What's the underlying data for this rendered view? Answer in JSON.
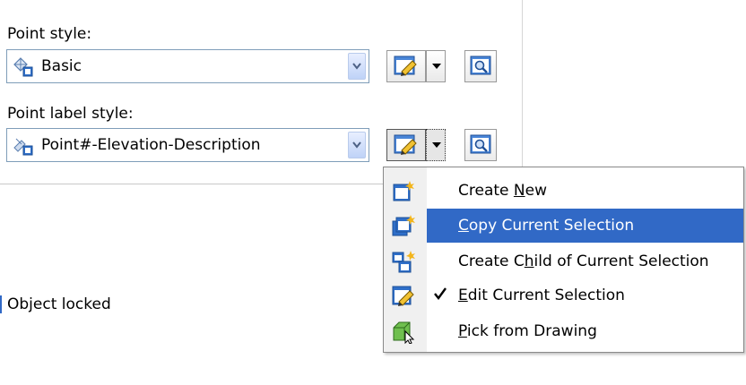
{
  "point_style": {
    "label": "Point style:",
    "selected": "Basic",
    "icon": "point-style-icon"
  },
  "point_label_style": {
    "label": "Point label style:",
    "selected": "Point#-Elevation-Description",
    "icon": "label-style-icon"
  },
  "menu": {
    "items": [
      {
        "label": "Create New",
        "mnemonic": "N",
        "icon": "create-new-icon"
      },
      {
        "label": "Copy Current Selection",
        "mnemonic": "C",
        "icon": "copy-selection-icon",
        "highlighted": true
      },
      {
        "label": "Create Child of Current Selection",
        "mnemonic": "h",
        "icon": "create-child-icon"
      },
      {
        "label": "Edit Current Selection",
        "mnemonic": "E",
        "icon": "edit-selection-icon",
        "checked": true
      },
      {
        "label": "Pick from Drawing",
        "mnemonic": "P",
        "icon": "pick-from-drawing-icon"
      }
    ]
  },
  "object_locked": {
    "label": "Object locked"
  },
  "colors": {
    "highlight": "#3169c6",
    "combo_border": "#7f9db9"
  }
}
